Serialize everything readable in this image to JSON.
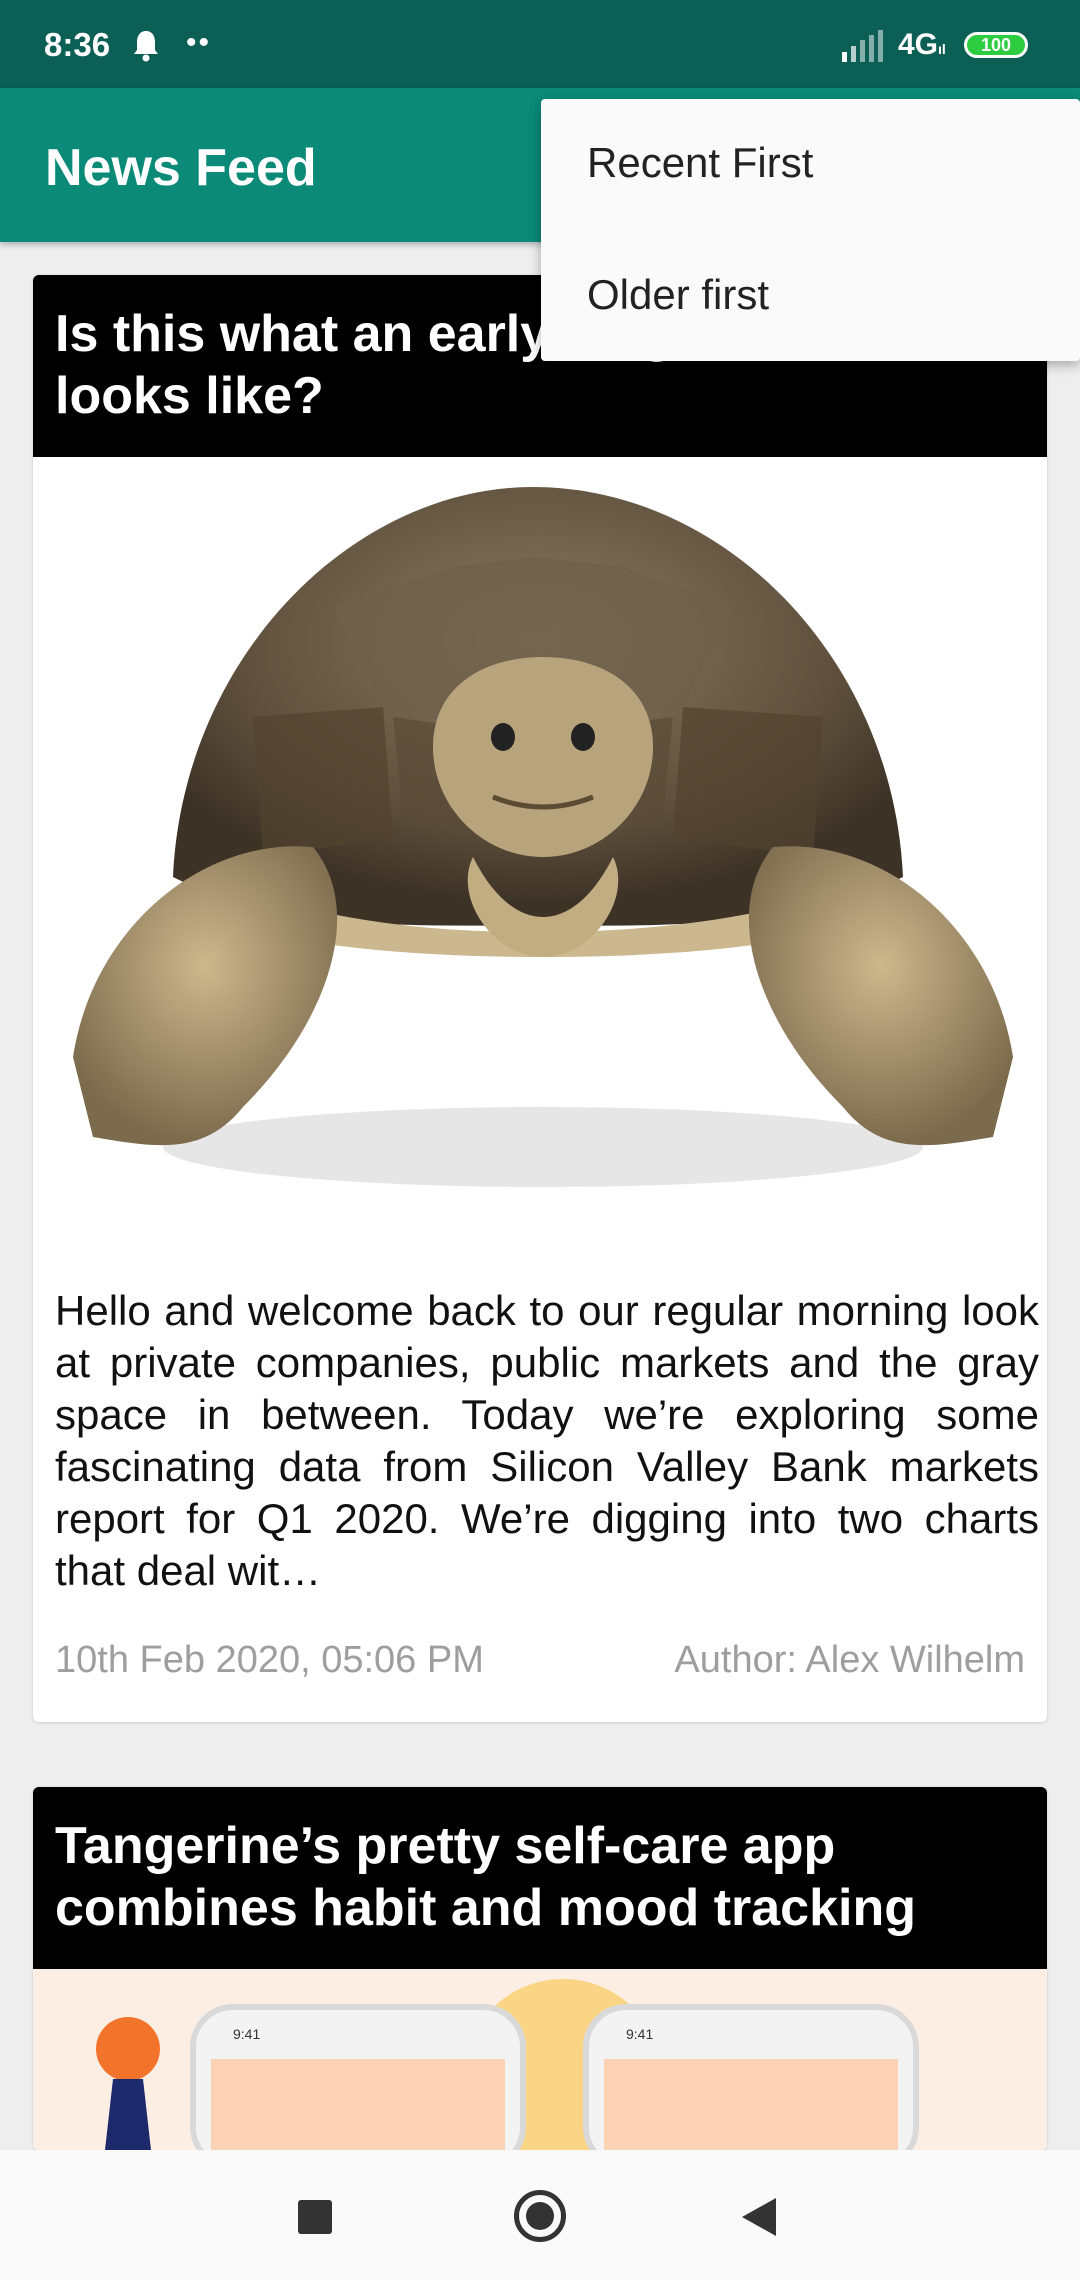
{
  "status_bar": {
    "time": "8:36",
    "dots": "••",
    "network": "4G",
    "network_sub": "ıl",
    "battery": "100"
  },
  "app_bar": {
    "title": "News Feed"
  },
  "menu": {
    "items": [
      {
        "label": "Recent First"
      },
      {
        "label": "Older first"
      }
    ]
  },
  "articles": [
    {
      "title": "Is this what an early-stage slowdown looks like?",
      "body": "Hello and welcome back to our regular morning look at private companies, public markets and the gray space in between. Today we’re exploring some fascinating data from Silicon Valley Bank markets report for Q1 2020. We’re digging into two charts that deal wit…",
      "date": "10th Feb 2020, 05:06 PM",
      "author": "Author: Alex Wilhelm"
    },
    {
      "title": "Tangerine’s pretty self-care app combines habit and mood tracking",
      "phone_time": "9:41"
    }
  ],
  "colors": {
    "status_bar": "#0b5f55",
    "app_bar": "#0b8a78",
    "battery": "#2ecc40"
  }
}
